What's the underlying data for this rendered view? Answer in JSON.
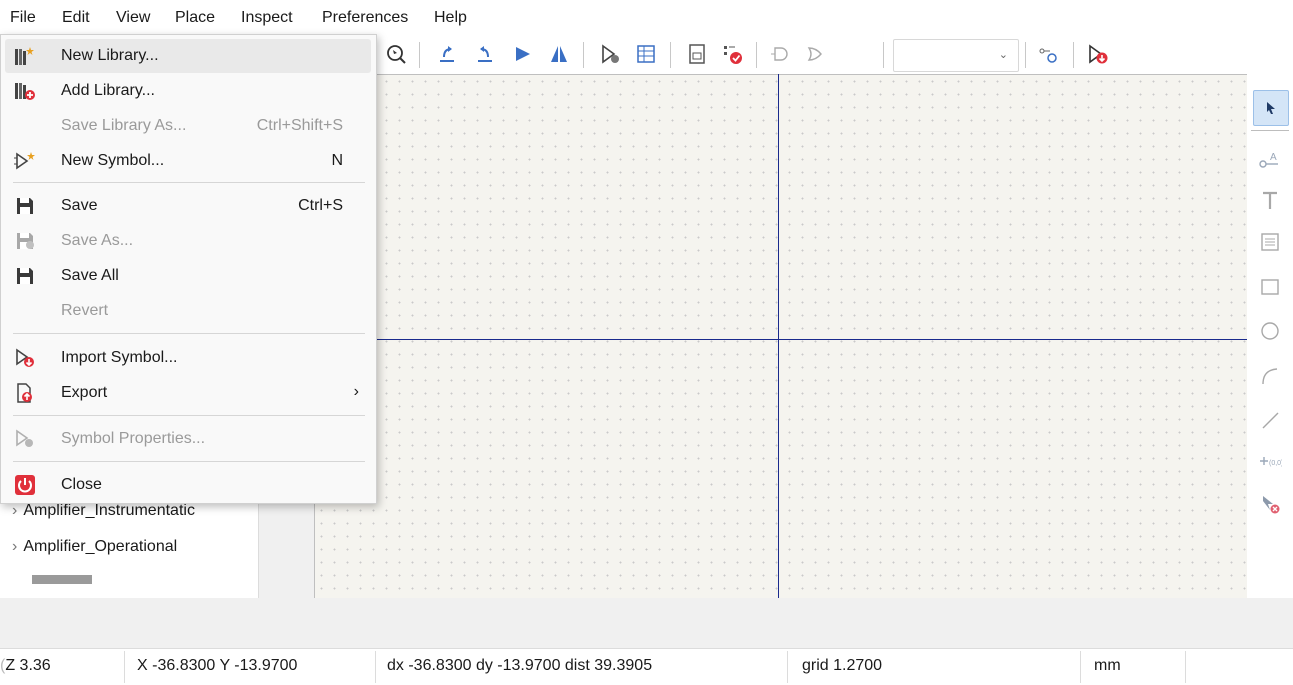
{
  "menubar": [
    "File",
    "Edit",
    "View",
    "Place",
    "Inspect",
    "Preferences",
    "Help"
  ],
  "file_menu": {
    "new_library": "New Library...",
    "add_library": "Add Library...",
    "save_library_as": "Save Library As...",
    "save_library_as_shortcut": "Ctrl+Shift+S",
    "new_symbol": "New Symbol...",
    "new_symbol_shortcut": "N",
    "save": "Save",
    "save_shortcut": "Ctrl+S",
    "save_as": "Save As...",
    "save_all": "Save All",
    "revert": "Revert",
    "import_symbol": "Import Symbol...",
    "export": "Export",
    "export_arrow": "›",
    "symbol_properties": "Symbol Properties...",
    "close": "Close"
  },
  "library_tree": {
    "items": [
      "Amplifier_Instrumentatic",
      "Amplifier_Operational"
    ],
    "expand_glyph": "›"
  },
  "status": {
    "zoom": "Z 3.36",
    "zoom_prefix": "(",
    "xy": "X -36.8300  Y -13.9700",
    "delta": "dx -36.8300  dy -13.9700  dist 39.3905",
    "grid": "grid 1.2700",
    "units": "mm"
  },
  "colors": {
    "accent": "#1a2a8c",
    "danger": "#e0303b",
    "canvas": "#f5f4ef"
  }
}
